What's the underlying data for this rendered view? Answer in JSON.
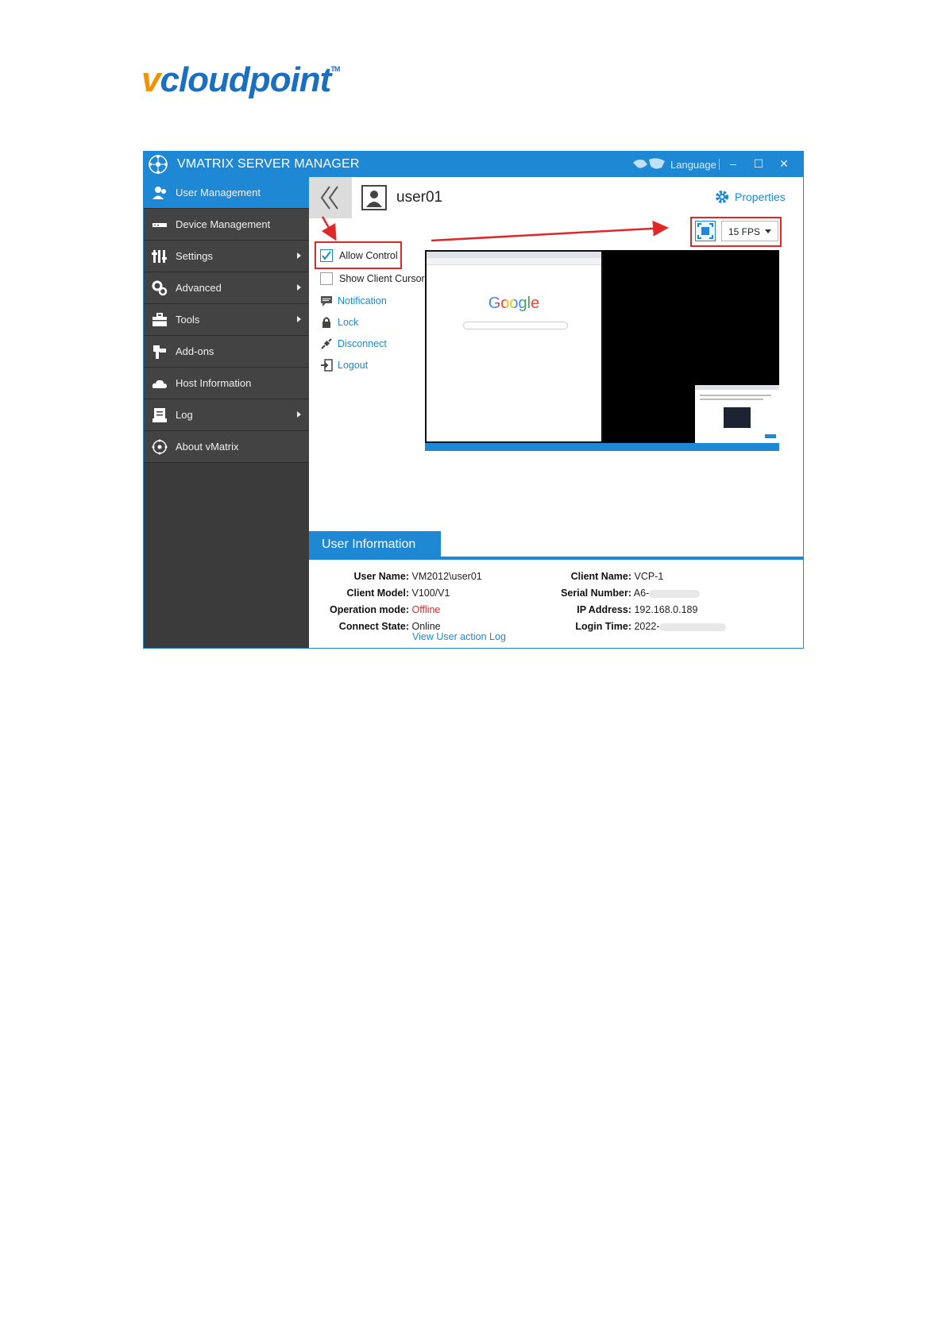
{
  "logo": {
    "v": "v",
    "rest": "cloudpoint",
    "tm": "TM"
  },
  "window": {
    "title": "VMATRIX SERVER MANAGER",
    "language": "Language",
    "controls": {
      "minimize": "‒",
      "maximize": "☐",
      "close": "✕"
    }
  },
  "sidebar": {
    "items": [
      {
        "label": "User Management",
        "icon": "users-icon"
      },
      {
        "label": "Device Management",
        "icon": "device-icon"
      },
      {
        "label": "Settings",
        "icon": "sliders-icon"
      },
      {
        "label": "Advanced",
        "icon": "gears-icon"
      },
      {
        "label": "Tools",
        "icon": "toolbox-icon"
      },
      {
        "label": "Add-ons",
        "icon": "puzzle-icon"
      },
      {
        "label": "Host Information",
        "icon": "cloud-icon"
      },
      {
        "label": "Log",
        "icon": "log-icon"
      },
      {
        "label": "About vMatrix",
        "icon": "vmatrix-icon"
      }
    ]
  },
  "header": {
    "user": "user01",
    "properties": "Properties"
  },
  "options": {
    "allow_control": "Allow Control",
    "allow_control_checked": true,
    "show_cursor": "Show Client Cursor",
    "show_cursor_checked": false,
    "notification": "Notification",
    "lock": "Lock",
    "disconnect": "Disconnect",
    "logout": "Logout"
  },
  "fps": {
    "value": "15 FPS"
  },
  "preview": {
    "google": "Google"
  },
  "user_info": {
    "tab": "User Information",
    "left": [
      {
        "key": "User Name:",
        "value": "VM2012\\user01"
      },
      {
        "key": "Client Model:",
        "value": "V100/V1"
      },
      {
        "key": "Operation mode:",
        "value": "Offline"
      },
      {
        "key": "Connect State:",
        "value": "Online"
      }
    ],
    "right": [
      {
        "key": "Client Name:",
        "value": "VCP-1"
      },
      {
        "key": "Serial Number:",
        "value": "A6-"
      },
      {
        "key": "IP Address:",
        "value": "192.168.0.189"
      },
      {
        "key": "Login Time:",
        "value": "2022-"
      }
    ],
    "log_link": "View User action Log"
  },
  "colors": {
    "accent": "#1e88d4",
    "sidebar": "#434343",
    "highlight": "#e02828",
    "logo_orange": "#f39200"
  }
}
